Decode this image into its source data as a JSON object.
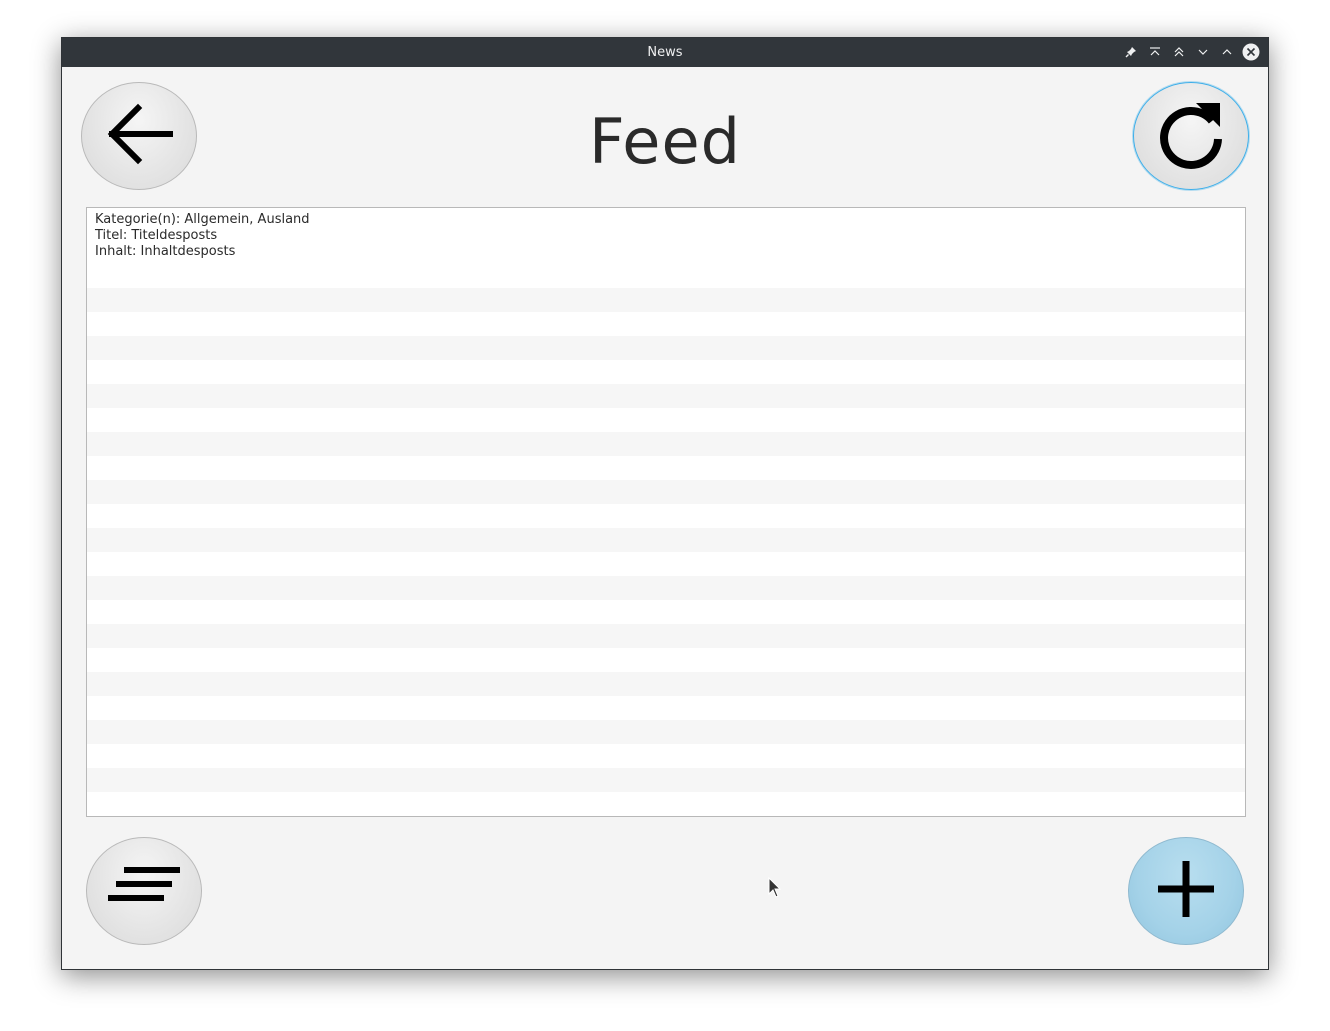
{
  "window": {
    "title": "News"
  },
  "titlebar_buttons": [
    {
      "name": "pin-icon"
    },
    {
      "name": "keep-above-icon"
    },
    {
      "name": "keep-below-icon"
    },
    {
      "name": "minimize-icon"
    },
    {
      "name": "maximize-icon"
    },
    {
      "name": "close-icon"
    }
  ],
  "header": {
    "title": "Feed",
    "back_icon": "arrow-left-icon",
    "refresh_icon": "refresh-icon"
  },
  "feed": {
    "items": [
      {
        "categories": "Kategorie(n): Allgemein, Ausland",
        "title": "Titel: Titeldesposts",
        "content": "Inhalt: Inhaltdesposts"
      }
    ]
  },
  "footer": {
    "menu_icon": "menu-lines-icon",
    "add_icon": "plus-icon"
  },
  "colors": {
    "titlebar": "#31363b",
    "background": "#f4f4f4",
    "add_button": "#a4d2e8",
    "focus_ring": "#3daee9"
  }
}
